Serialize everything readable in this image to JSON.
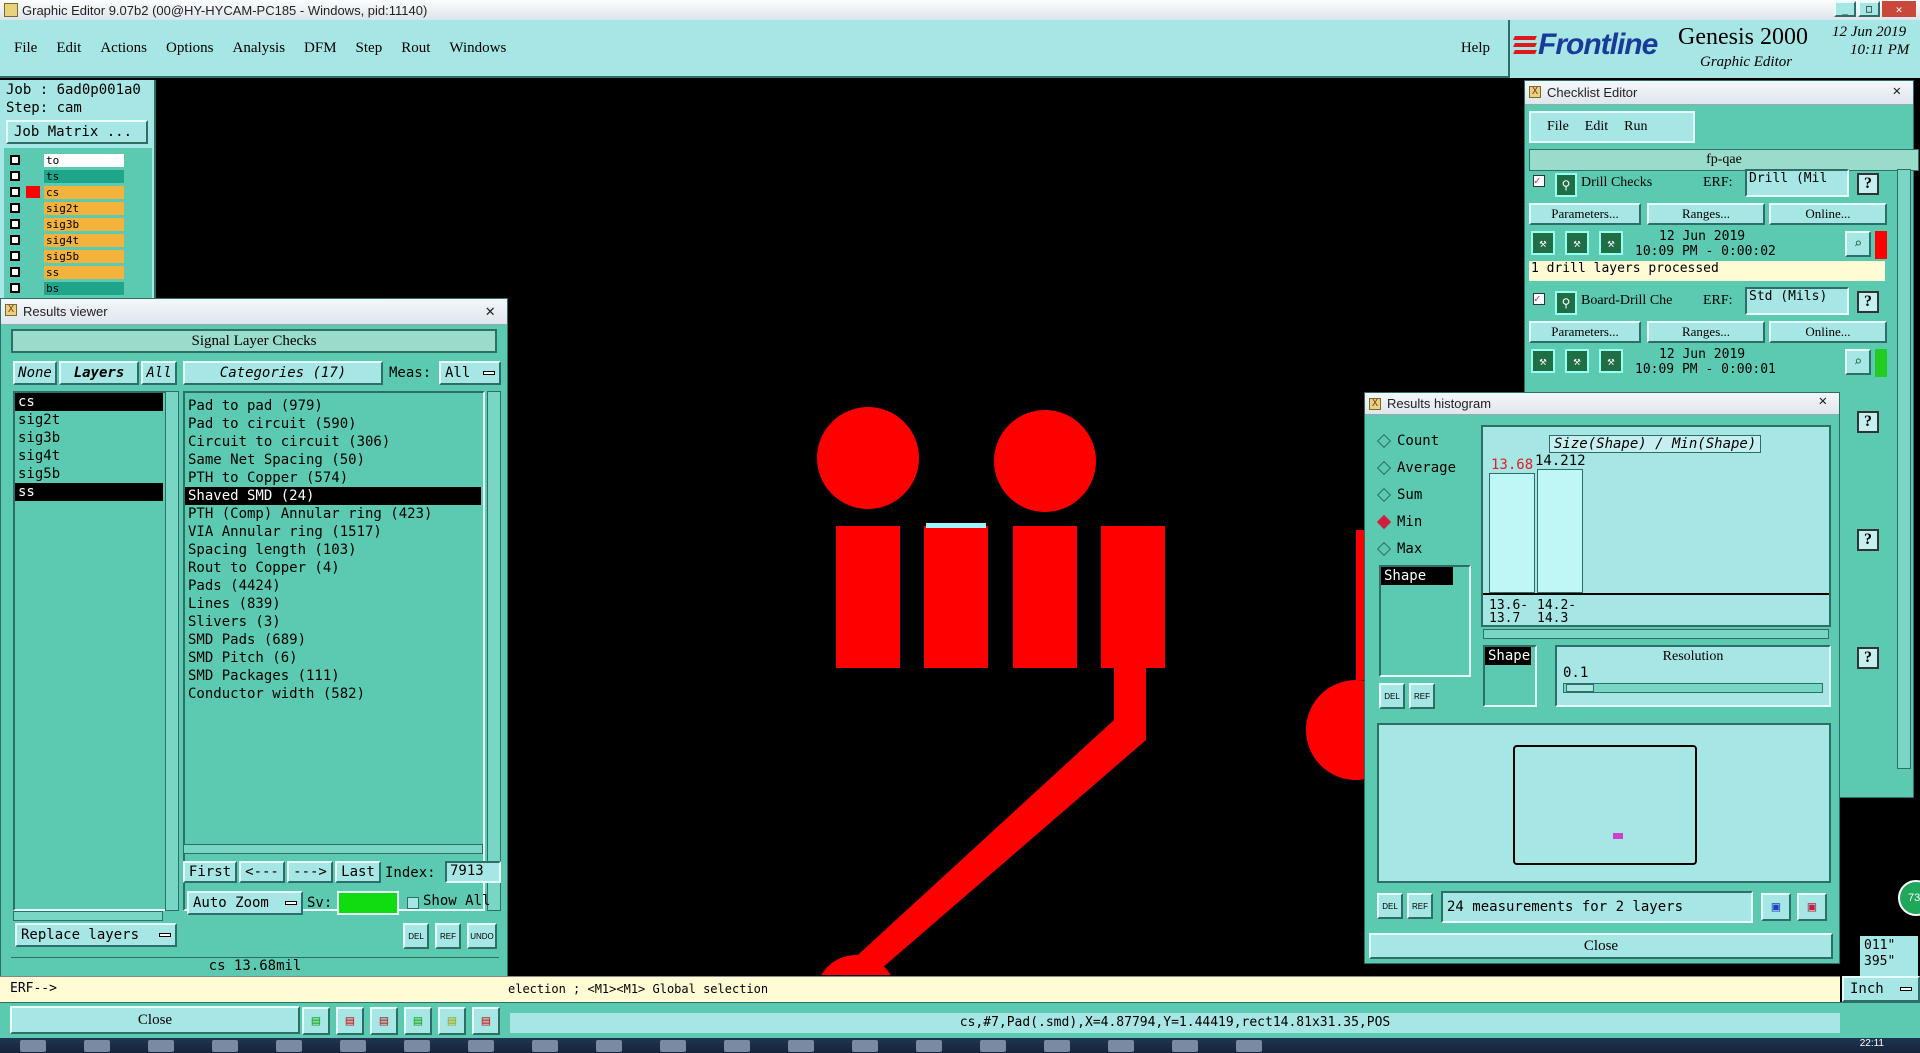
{
  "window": {
    "title": "Graphic Editor 9.07b2 (00@HY-HYCAM-PC185 - Windows, pid:11140)"
  },
  "menu": [
    "File",
    "Edit",
    "Actions",
    "Options",
    "Analysis",
    "DFM",
    "Step",
    "Rout",
    "Windows"
  ],
  "help": "Help",
  "brand": {
    "logo": "Frontline",
    "product": "Genesis 2000",
    "subtitle": "Graphic Editor",
    "date": "12 Jun 2019",
    "time": "10:11 PM"
  },
  "job": {
    "job_line": "Job : 6ad0p001a0",
    "step_line": "Step: cam",
    "job_matrix": "Job Matrix ..."
  },
  "layers": [
    {
      "name": "to",
      "color": "#ffffff"
    },
    {
      "name": "ts",
      "color": "#1ea58a"
    },
    {
      "name": "cs",
      "color": "#f3b23c"
    },
    {
      "name": "sig2t",
      "color": "#f3b23c"
    },
    {
      "name": "sig3b",
      "color": "#f3b23c"
    },
    {
      "name": "sig4t",
      "color": "#f3b23c"
    },
    {
      "name": "sig5b",
      "color": "#f3b23c"
    },
    {
      "name": "ss",
      "color": "#f3b23c"
    },
    {
      "name": "bs",
      "color": "#1ea58a"
    }
  ],
  "results_viewer": {
    "title": "Results viewer",
    "heading": "Signal Layer Checks",
    "none_btn": "None",
    "layers_btn": "Layers",
    "all_btn": "All",
    "categories_label": "Categories (17)",
    "meas_label": "Meas:",
    "meas_value": "All",
    "layer_list": [
      "cs",
      "sig2t",
      "sig3b",
      "sig4t",
      "sig5b",
      "ss"
    ],
    "categories": [
      "Pad to pad (979)",
      "Pad to circuit (590)",
      "Circuit to circuit (306)",
      "Same Net Spacing (50)",
      "PTH to Copper (574)",
      "Shaved SMD (24)",
      "PTH (Comp) Annular ring (423)",
      "VIA Annular ring (1517)",
      "Spacing length (103)",
      "Rout to Copper (4)",
      "Pads (4424)",
      "Lines (839)",
      "Slivers (3)",
      "SMD Pads (689)",
      "SMD Pitch (6)",
      "SMD Packages (111)",
      "Conductor width (582)"
    ],
    "first": "First",
    "prev": "<---",
    "next": "--->",
    "last": "Last",
    "index_label": "Index:",
    "index_value": "7913",
    "auto_zoom": "Auto Zoom",
    "sv_label": "Sv:",
    "show_all": "Show All",
    "replace_layers": "Replace layers",
    "status": "cs 13.68mil",
    "close": "Close",
    "del": "DEL",
    "ref": "REF",
    "undo": "UNDO"
  },
  "erf_line": "ERF-->",
  "erf_hint": "election ; <M1><M1> Global selection",
  "status_bar": "cs,#7,Pad(.smd),X=4.87794,Y=1.44419,rect14.81x31.35,POS",
  "units": "Inch",
  "coords_partial": [
    "011\"",
    "395\""
  ],
  "checklist": {
    "title": "Checklist Editor",
    "menu": [
      "File",
      "Edit",
      "Run"
    ],
    "name": "fp-qae",
    "checks": [
      {
        "name": "Drill Checks",
        "erf_label": "ERF:",
        "erf_value": "Drill (Mil",
        "params": "Parameters...",
        "ranges": "Ranges...",
        "online": "Online...",
        "date": "12 Jun 2019",
        "time": "10:09 PM - 0:00:02",
        "message": "1 drill layers processed",
        "status_color": "#ff0000"
      },
      {
        "name": "Board-Drill Che",
        "erf_label": "ERF:",
        "erf_value": "Std (Mils)",
        "params": "Parameters...",
        "ranges": "Ranges...",
        "online": "Online...",
        "date": "12 Jun 2019",
        "time": "10:09 PM - 0:00:01",
        "status_color": "#22cc22"
      }
    ]
  },
  "histogram": {
    "title": "Results histogram",
    "options": [
      "Count",
      "Average",
      "Sum",
      "Min",
      "Max"
    ],
    "selected_option": "Min",
    "list_item": "Shape",
    "chart_title": "Size(Shape) / Min(Shape)",
    "bar_labels": [
      "13.68",
      "14.212"
    ],
    "bin_labels": [
      "13.6-\n13.7",
      "14.2-\n14.3"
    ],
    "shape_label": "Shape",
    "resolution_label": "Resolution",
    "resolution_value": "0.1",
    "measurements": "24 measurements for 2 layers",
    "close": "Close",
    "del": "DEL",
    "ref": "REF"
  },
  "badge": "73",
  "taskbar_time": "22:11"
}
